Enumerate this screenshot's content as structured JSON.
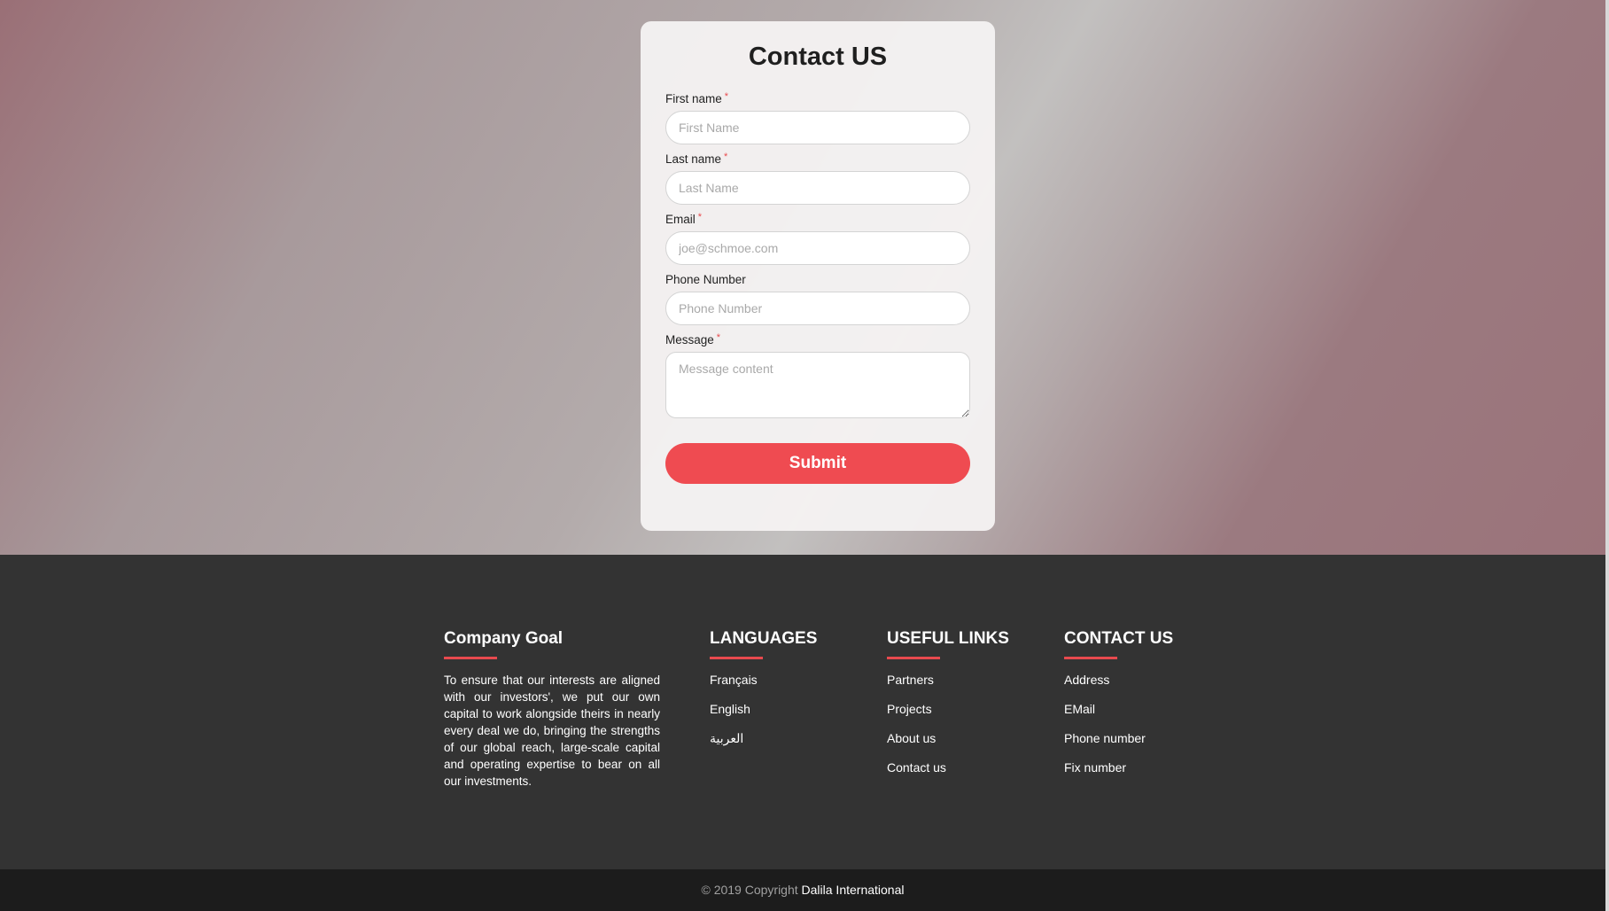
{
  "form": {
    "title": "Contact US",
    "required_mark": "*",
    "fields": {
      "first_name": {
        "label": "First name",
        "placeholder": "First Name",
        "required": true
      },
      "last_name": {
        "label": "Last name",
        "placeholder": "Last Name",
        "required": true
      },
      "email": {
        "label": "Email",
        "placeholder": "joe@schmoe.com",
        "required": true
      },
      "phone": {
        "label": "Phone Number",
        "placeholder": "Phone Number",
        "required": false
      },
      "message": {
        "label": "Message",
        "placeholder": "Message content",
        "required": true
      }
    },
    "submit_label": "Submit",
    "submit_color": "#ef4b51"
  },
  "footer": {
    "accent_color": "#e84a4e",
    "company_goal": {
      "title": "Company Goal",
      "text": "To ensure that our interests are aligned with our investors', we put our own capital to work alongside theirs in nearly every deal we do, bringing the strengths of our global reach, large-scale capital and operating expertise to bear on all our investments."
    },
    "languages": {
      "title": "LANGUAGES",
      "items": [
        "Français",
        "English",
        "العربية"
      ]
    },
    "useful_links": {
      "title": "USEFUL LINKS",
      "items": [
        "Partners",
        "Projects",
        "About us",
        "Contact us"
      ]
    },
    "contact_us": {
      "title": "CONTACT US",
      "items": [
        "Address",
        "EMail",
        "Phone number",
        "Fix number"
      ]
    }
  },
  "copyright": {
    "prefix": "© 2019 Copyright ",
    "brand": "Dalila International"
  }
}
